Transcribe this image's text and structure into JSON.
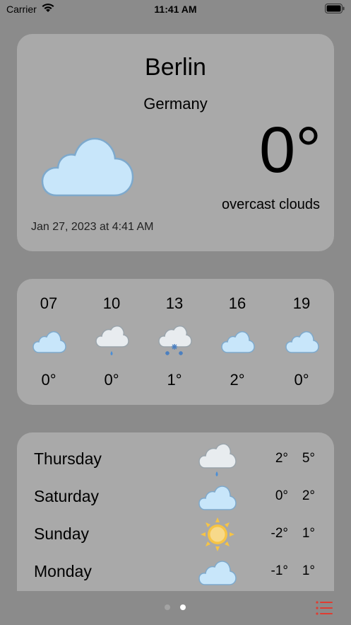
{
  "status": {
    "carrier": "Carrier",
    "time": "11:41 AM"
  },
  "current": {
    "city": "Berlin",
    "country": "Germany",
    "temperature": "0°",
    "description": "overcast clouds",
    "updated": "Jan 27, 2023 at 4:41 AM",
    "icon": "cloud-icon"
  },
  "hourly": [
    {
      "hour": "07",
      "temp": "0°",
      "icon": "cloud-icon"
    },
    {
      "hour": "10",
      "temp": "0°",
      "icon": "cloud-rain-icon"
    },
    {
      "hour": "13",
      "temp": "1°",
      "icon": "cloud-snow-icon"
    },
    {
      "hour": "16",
      "temp": "2°",
      "icon": "cloud-icon"
    },
    {
      "hour": "19",
      "temp": "0°",
      "icon": "cloud-icon"
    }
  ],
  "daily": [
    {
      "day": "Thursday",
      "min": "2°",
      "max": "5°",
      "icon": "cloud-rain-icon"
    },
    {
      "day": "Saturday",
      "min": "0°",
      "max": "2°",
      "icon": "cloud-icon"
    },
    {
      "day": "Sunday",
      "min": "-2°",
      "max": "1°",
      "icon": "sun-icon"
    },
    {
      "day": "Monday",
      "min": "-1°",
      "max": "1°",
      "icon": "cloud-icon"
    }
  ],
  "pager": {
    "pages": 2,
    "current": 2
  },
  "colors": {
    "background": "#8b8b8b",
    "card": "#a9a9a9",
    "cloud_fill": "#c8e6fa",
    "cloud_stroke": "#7ea9cc",
    "sun": "#f6c445",
    "accent": "#e03c31"
  }
}
